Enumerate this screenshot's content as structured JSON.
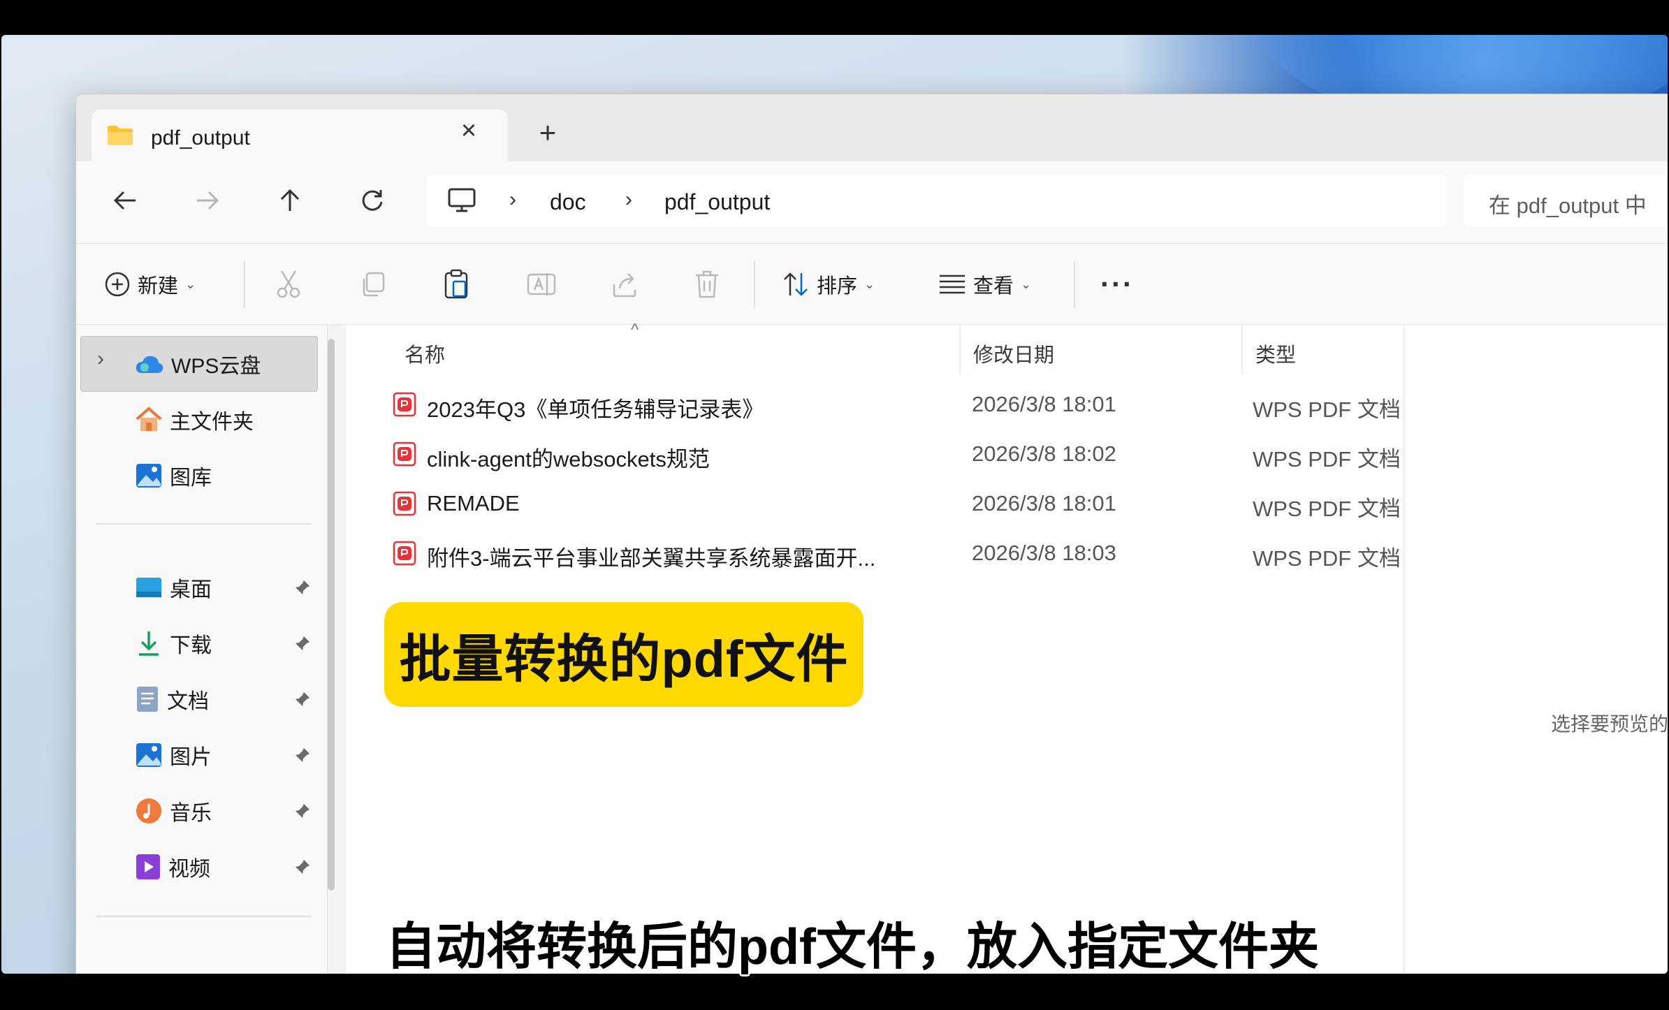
{
  "window": {
    "tab_title": "pdf_output",
    "new_tab_label": "+"
  },
  "breadcrumb": [
    "doc",
    "pdf_output"
  ],
  "search": {
    "placeholder": "在 pdf_output 中"
  },
  "toolbar": {
    "new_label": "新建",
    "sort_label": "排序",
    "view_label": "查看",
    "more_label": "···"
  },
  "sidebar": {
    "top": [
      {
        "label": "WPS云盘",
        "icon": "cloud-icon"
      },
      {
        "label": "主文件夹",
        "icon": "home-icon"
      },
      {
        "label": "图库",
        "icon": "gallery-icon"
      }
    ],
    "quick": [
      {
        "label": "桌面",
        "icon": "desktop-icon"
      },
      {
        "label": "下载",
        "icon": "download-icon"
      },
      {
        "label": "文档",
        "icon": "documents-icon"
      },
      {
        "label": "图片",
        "icon": "pictures-icon"
      },
      {
        "label": "音乐",
        "icon": "music-icon"
      },
      {
        "label": "视频",
        "icon": "videos-icon"
      }
    ]
  },
  "columns": {
    "name": "名称",
    "date": "修改日期",
    "type": "类型"
  },
  "files": [
    {
      "name": "2023年Q3《单项任务辅导记录表》",
      "date": "2026/3/8 18:01",
      "type": "WPS PDF 文档"
    },
    {
      "name": "clink-agent的websockets规范",
      "date": "2026/3/8 18:02",
      "type": "WPS PDF 文档"
    },
    {
      "name": "REMADE",
      "date": "2026/3/8 18:01",
      "type": "WPS PDF 文档"
    },
    {
      "name": "附件3-端云平台事业部关翼共享系统暴露面开...",
      "date": "2026/3/8 18:03",
      "type": "WPS PDF 文档"
    }
  ],
  "preview": {
    "message": "选择要预览的"
  },
  "overlay": {
    "badge": "批量转换的pdf文件",
    "caption": "自动将转换后的pdf文件，放入指定文件夹"
  },
  "colors": {
    "badge": "#ffd900",
    "pdf_icon": "#e5343a",
    "accent": "#0067c0"
  }
}
